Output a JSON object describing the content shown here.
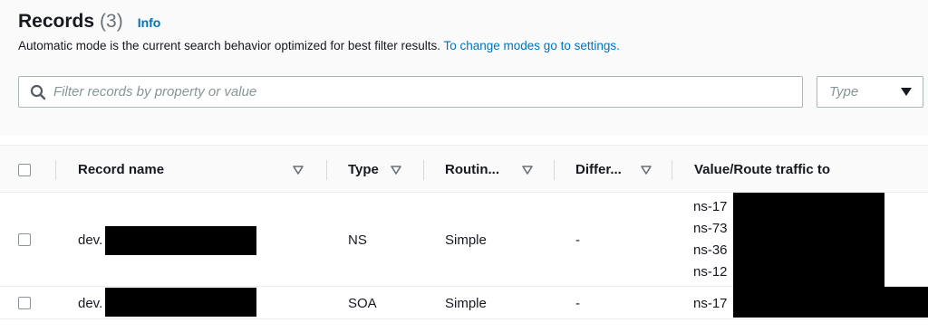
{
  "header": {
    "title": "Records",
    "count": "(3)",
    "info_label": "Info",
    "description": "Automatic mode is the current search behavior optimized for best filter results.",
    "description_link": "To change modes go to settings."
  },
  "filter": {
    "placeholder": "Filter records by property or value",
    "value": "",
    "type_placeholder": "Type"
  },
  "table": {
    "columns": [
      {
        "label": "Record name"
      },
      {
        "label": "Type"
      },
      {
        "label": "Routin..."
      },
      {
        "label": "Differ..."
      },
      {
        "label": "Value/Route traffic to"
      }
    ],
    "rows": [
      {
        "record_name": "dev.",
        "type": "NS",
        "routing": "Simple",
        "differentiator": "-",
        "values": [
          "ns-17",
          "ns-73",
          "ns-36",
          "ns-12"
        ]
      },
      {
        "record_name": "dev.",
        "type": "SOA",
        "routing": "Simple",
        "differentiator": "-",
        "values": [
          "ns-17"
        ]
      }
    ]
  }
}
